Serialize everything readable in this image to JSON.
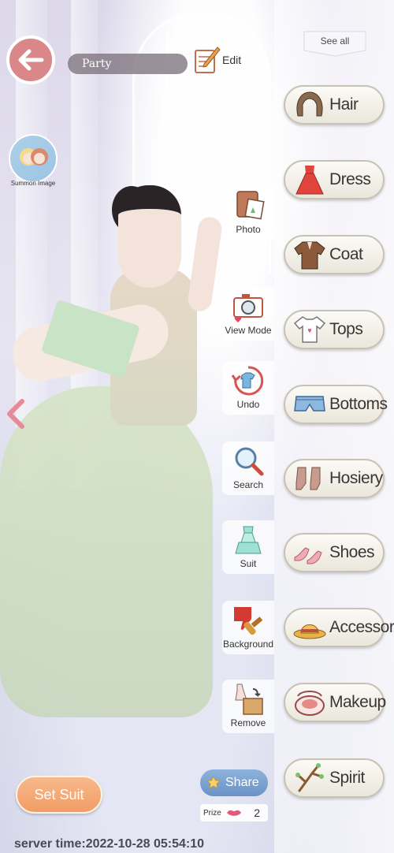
{
  "header": {
    "back_icon": "back-arrow-icon",
    "outfit_name": "Party",
    "edit_label": "Edit"
  },
  "summon": {
    "label": "Summon Image"
  },
  "toolbar": [
    {
      "label": "Photo",
      "icon": "photo-album-icon"
    },
    {
      "label": "View Mode",
      "icon": "camera-icon"
    },
    {
      "label": "Undo",
      "icon": "undo-shirt-icon"
    },
    {
      "label": "Search",
      "icon": "magnifier-icon"
    },
    {
      "label": "Suit",
      "icon": "suit-dress-icon"
    },
    {
      "label": "Background",
      "icon": "paint-brush-icon"
    },
    {
      "label": "Remove",
      "icon": "remove-box-icon"
    }
  ],
  "categories": {
    "see_all": "See all",
    "items": [
      {
        "label": "Hair",
        "icon": "hair-icon"
      },
      {
        "label": "Dress",
        "icon": "dress-icon"
      },
      {
        "label": "Coat",
        "icon": "coat-icon"
      },
      {
        "label": "Tops",
        "icon": "tshirt-icon"
      },
      {
        "label": "Bottoms",
        "icon": "shorts-icon"
      },
      {
        "label": "Hosiery",
        "icon": "socks-icon"
      },
      {
        "label": "Shoes",
        "icon": "heels-icon"
      },
      {
        "label": "Accessory",
        "icon": "hat-icon"
      },
      {
        "label": "Makeup",
        "icon": "compact-icon"
      },
      {
        "label": "Spirit",
        "icon": "branch-icon"
      }
    ]
  },
  "footer": {
    "set_suit": "Set Suit",
    "share": "Share",
    "prize_label": "Prize",
    "prize_count": "2",
    "server_time": "server time:2022-10-28 05:54:10"
  },
  "colors": {
    "back_button": "#d98789",
    "set_suit": "#f19c64",
    "share": "#6b92c6",
    "panel_button_border": "#c8c2b4"
  }
}
